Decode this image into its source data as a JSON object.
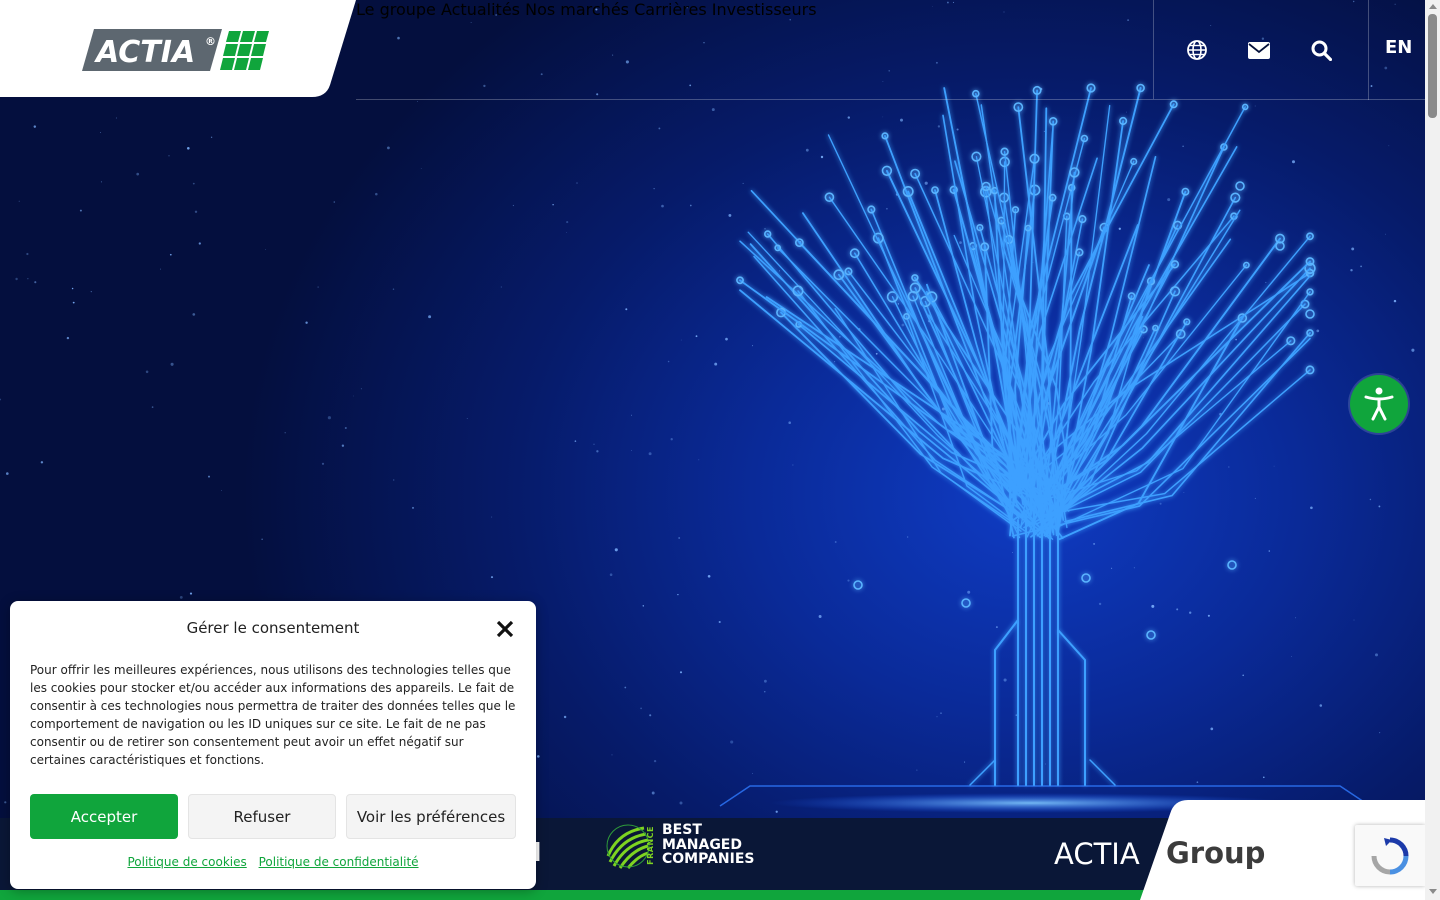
{
  "header": {
    "logo_text": "ACTIA",
    "logo_mark": "®",
    "nav": [
      {
        "label": "Le groupe"
      },
      {
        "label": "Actualités"
      },
      {
        "label": "Nos marchés"
      },
      {
        "label": "Carrières"
      },
      {
        "label": "Investisseurs"
      }
    ],
    "icons": [
      "globe-icon",
      "mail-icon",
      "search-icon"
    ],
    "lang": "EN"
  },
  "band": {
    "partial_text": "H",
    "bmc_france": "FRANCE",
    "bmc_lines": [
      "BEST",
      "MANAGED",
      "COMPANIES"
    ],
    "actia": "ACTIA",
    "group": "Group"
  },
  "consent": {
    "title": "Gérer le consentement",
    "text": "Pour offrir les meilleures expériences, nous utilisons des technologies telles que les cookies pour stocker et/ou accéder aux informations des appareils. Le fait de consentir à ces technologies nous permettra de traiter des données telles que le comportement de navigation ou les ID uniques sur ce site. Le fait de ne pas consentir ou de retirer son consentement peut avoir un effet négatif sur certaines caractéristiques et fonctions.",
    "accept": "Accepter",
    "refuse": "Refuser",
    "preferences": "Voir les préférences",
    "cookie_policy": "Politique de cookies",
    "privacy_policy": "Politique de confidentialité"
  },
  "colors": {
    "brand_green": "#10a53c",
    "hero_blue": "#0a2a98",
    "band_dark": "#0a1737"
  }
}
